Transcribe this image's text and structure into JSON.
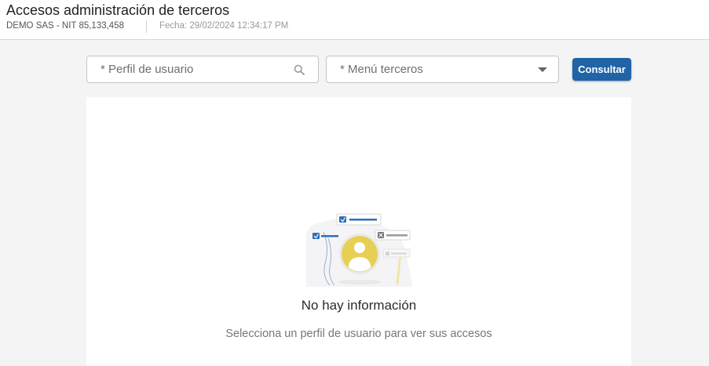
{
  "header": {
    "title": "Accesos administración de terceros",
    "company": "DEMO SAS - NIT 85,133,458",
    "date": "Fecha: 29/02/2024 12:34:17 PM"
  },
  "filters": {
    "profile_placeholder": "* Perfil de usuario",
    "profile_icon": "search-icon",
    "menu_placeholder": "* Menú terceros",
    "menu_icon": "caret-down-icon",
    "consult_label": "Consultar",
    "accent_color": "#2063a6"
  },
  "empty_state": {
    "title": "No hay información",
    "subtitle": "Selecciona un perfil de usuario para ver sus accesos",
    "illustration_icon": "user-avatar-illustration",
    "illustration_color": "#e6cf53"
  }
}
